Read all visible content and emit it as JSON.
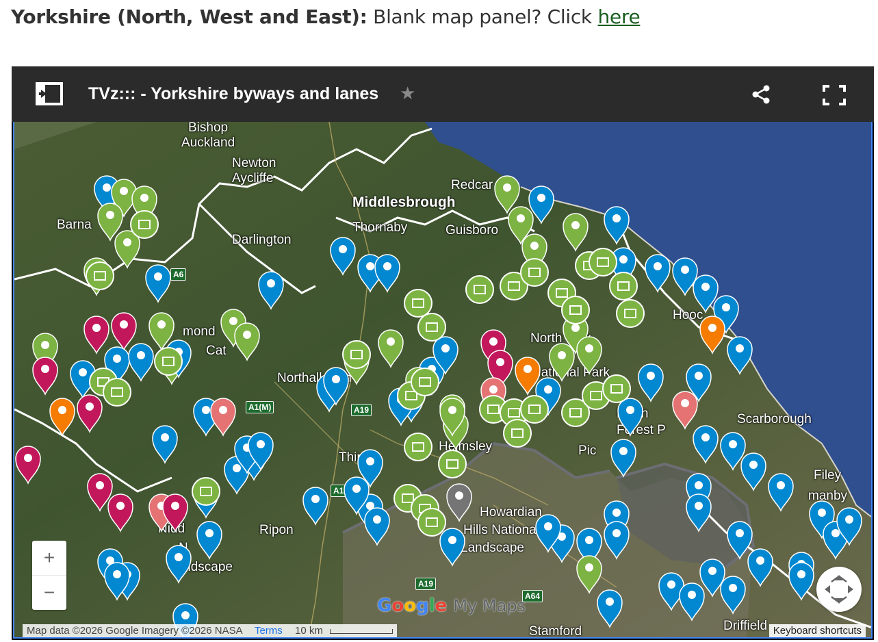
{
  "heading": {
    "region": "Yorkshire (North, West and East):",
    "prompt": "Blank map panel? Click",
    "link": "here"
  },
  "map": {
    "title": "TVz::: - Yorkshire byways and lanes",
    "icons": {
      "sidebar_toggle": "sidebar-toggle-icon",
      "star": "star-icon",
      "share": "share-icon",
      "fullscreen": "fullscreen-icon"
    },
    "colors": {
      "topbar": "#2b2b2b",
      "border": "#4285f4",
      "pin_blue": "#0288d1",
      "pin_green": "#7cb342",
      "pin_magenta": "#c2185b",
      "pin_orange": "#f57c00",
      "pin_red": "#e57373",
      "pin_grey": "#757575"
    },
    "places": [
      "Bishop",
      "Auckland",
      "Newton",
      "Aycliffe",
      "Redcar",
      "Middlesbrough",
      "Thornaby",
      "Guisboro",
      "Barna",
      "Darlington",
      "Hooc",
      "mond",
      "Cat",
      "Northallerton",
      "North York",
      "National Park",
      "Thir",
      "Helmsley",
      "Scarborough",
      "Filey",
      "manby",
      "Howardian",
      "Hills National",
      "Landscape",
      "Ripon",
      "Nidd",
      "N",
      "Landscape",
      "Stamford",
      "Driffield",
      "North",
      "Forest P",
      "Pic"
    ],
    "roads": [
      "A1(M)",
      "A19",
      "A1",
      "A19",
      "A64",
      "A6"
    ],
    "zoom_in": "+",
    "zoom_out": "−",
    "attribution": "Map data ©2026 Google Imagery ©2026 NASA",
    "terms": "Terms",
    "scale": "10 km",
    "keyboard_shortcuts": "Keyboard shortcuts",
    "logo_google": "Google",
    "logo_mymaps": "My Maps"
  }
}
